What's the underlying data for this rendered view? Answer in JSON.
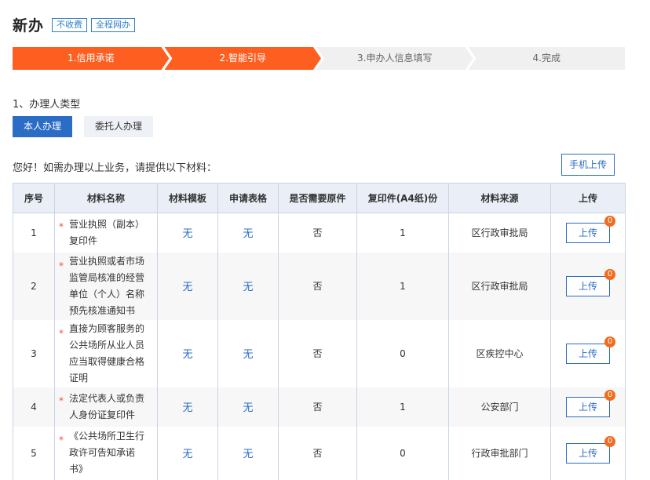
{
  "header": {
    "title": "新办",
    "tags": [
      "不收费",
      "全程网办"
    ]
  },
  "steps": [
    {
      "label": "1.信用承诺",
      "active": true
    },
    {
      "label": "2.智能引导",
      "active": true
    },
    {
      "label": "3.申办人信息填写",
      "active": false
    },
    {
      "label": "4.完成",
      "active": false
    }
  ],
  "applicant": {
    "section_label": "1、办理人类型",
    "options": [
      "本人办理",
      "委托人办理"
    ],
    "selected": "本人办理"
  },
  "notice": "您好！如需办理以上业务，请提供以下材料：",
  "mobile_upload_label": "手机上传",
  "table": {
    "headers": [
      "序号",
      "材料名称",
      "材料模板",
      "申请表格",
      "是否需要原件",
      "复印件(A4纸)份",
      "材料来源",
      "上传"
    ],
    "rows": [
      {
        "no": "1",
        "name": [
          "营业执照（副本）",
          "复印件"
        ],
        "template": "无",
        "form": "无",
        "original": "否",
        "copies": "1",
        "source": "区行政审批局",
        "upload": "上传",
        "count": "0"
      },
      {
        "no": "2",
        "name": [
          "营业执照或者市场",
          "监管局核准的经营",
          "单位（个人）名称",
          "预先核准通知书"
        ],
        "template": "无",
        "form": "无",
        "original": "否",
        "copies": "1",
        "source": "区行政审批局",
        "upload": "上传",
        "count": "0"
      },
      {
        "no": "3",
        "name": [
          "直接为顾客服务的",
          "公共场所从业人员",
          "应当取得健康合格",
          "证明"
        ],
        "template": "无",
        "form": "无",
        "original": "否",
        "copies": "0",
        "source": "区疾控中心",
        "upload": "上传",
        "count": "0"
      },
      {
        "no": "4",
        "name": [
          "法定代表人或负责",
          "人身份证复印件"
        ],
        "template": "无",
        "form": "无",
        "original": "否",
        "copies": "1",
        "source": "公安部门",
        "upload": "上传",
        "count": "0"
      },
      {
        "no": "5",
        "name": [
          "《公共场所卫生行",
          "政许可告知承诺",
          "书》"
        ],
        "template": "无",
        "form": "无",
        "original": "否",
        "copies": "0",
        "source": "行政审批部门",
        "upload": "上传",
        "count": "0"
      }
    ]
  },
  "colors": {
    "accent": "#fe5f21",
    "primary": "#2b6cc4",
    "badge": "#f36b1c"
  }
}
